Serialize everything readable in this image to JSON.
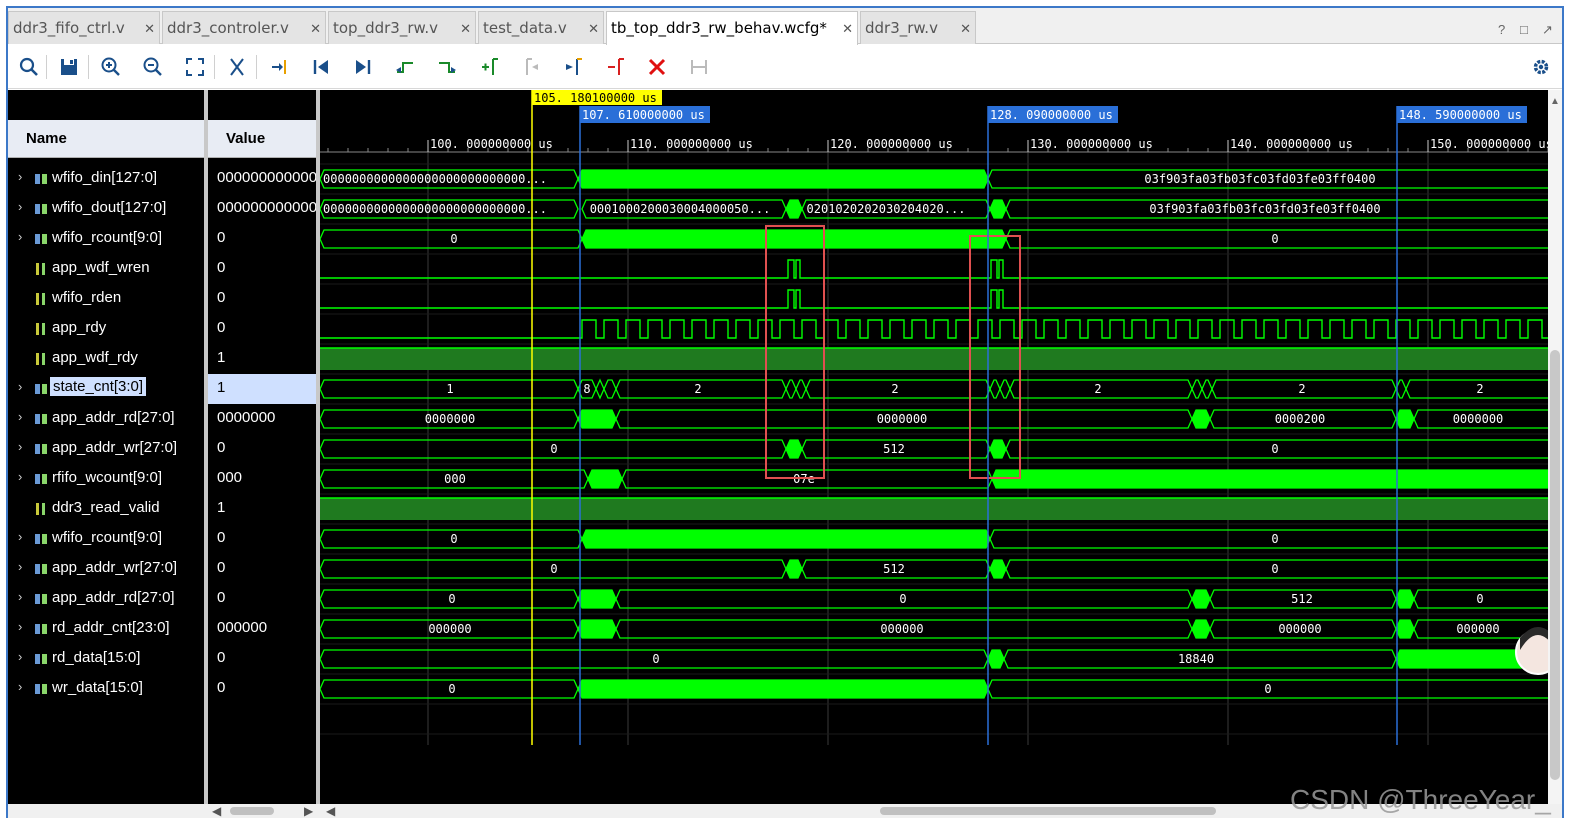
{
  "tabs": [
    {
      "label": "ddr3_fifo_ctrl.v",
      "active": false
    },
    {
      "label": "ddr3_controler.v",
      "active": false
    },
    {
      "label": "top_ddr3_rw.v",
      "active": false
    },
    {
      "label": "test_data.v",
      "active": false
    },
    {
      "label": "tb_top_ddr3_rw_behav.wcfg*",
      "active": true
    },
    {
      "label": "ddr3_rw.v",
      "active": false
    }
  ],
  "window_controls": [
    "?",
    "□",
    "↗"
  ],
  "toolbar_icons": [
    "search-icon",
    "save-icon",
    "zoom-in-icon",
    "zoom-out-icon",
    "zoom-fit-icon",
    "cut-icon",
    "go-to-cursor-icon",
    "go-to-time-zero-icon",
    "go-to-last-time-icon",
    "previous-transition-icon",
    "next-transition-icon",
    "add-marker-icon",
    "previous-marker-icon",
    "next-marker-icon",
    "swap-cursors-icon",
    "delete-icon",
    "snap-to-transition-icon",
    "gear-icon"
  ],
  "columns": {
    "name": "Name",
    "value": "Value"
  },
  "signals": [
    {
      "name": "wfifo_din[127:0]",
      "value": "000000000000000",
      "bus": true
    },
    {
      "name": "wfifo_dout[127:0]",
      "value": "000000000000000",
      "bus": true
    },
    {
      "name": "wfifo_rcount[9:0]",
      "value": "0",
      "bus": true
    },
    {
      "name": "app_wdf_wren",
      "value": "0",
      "bus": false
    },
    {
      "name": "wfifo_rden",
      "value": "0",
      "bus": false
    },
    {
      "name": "app_rdy",
      "value": "0",
      "bus": false
    },
    {
      "name": "app_wdf_rdy",
      "value": "1",
      "bus": false
    },
    {
      "name": "state_cnt[3:0]",
      "value": "1",
      "bus": true,
      "selected": true
    },
    {
      "name": "app_addr_rd[27:0]",
      "value": "0000000",
      "bus": true
    },
    {
      "name": "app_addr_wr[27:0]",
      "value": "0",
      "bus": true
    },
    {
      "name": "rfifo_wcount[9:0]",
      "value": "000",
      "bus": true
    },
    {
      "name": "ddr3_read_valid",
      "value": "1",
      "bus": false
    },
    {
      "name": "wfifo_rcount[9:0]",
      "value": "0",
      "bus": true
    },
    {
      "name": "app_addr_wr[27:0]",
      "value": "0",
      "bus": true
    },
    {
      "name": "app_addr_rd[27:0]",
      "value": "0",
      "bus": true
    },
    {
      "name": "rd_addr_cnt[23:0]",
      "value": "000000",
      "bus": true
    },
    {
      "name": "rd_data[15:0]",
      "value": "0",
      "bus": true
    },
    {
      "name": "wr_data[15:0]",
      "value": "0",
      "bus": true
    }
  ],
  "timeline": {
    "unit": "us",
    "ticks": [
      "100. 000000000 us",
      "110. 000000000 us",
      "120. 000000000 us",
      "130. 000000000 us",
      "140. 000000000 us",
      "150. 000000000 us"
    ],
    "cursor": "105. 180100000  us",
    "markers": [
      "107. 610000000  us",
      "128. 090000000  us",
      "148. 590000000  us"
    ]
  },
  "wave_labels": {
    "din_a": "0000000000000000000000000000...",
    "din_b": "03f903fa03fb03fc03fd03fe03ff0400",
    "dout_a": "0000000000000000000000000000...",
    "dout_b": "0001000200030004000050...",
    "dout_c": "0201020202030204020...",
    "dout_d": "03f903fa03fb03fc03fd03fe03ff0400",
    "rcount_a": "0",
    "rcount_b": "0",
    "state_1": "1",
    "state_8": "8",
    "state_2a": "2",
    "state_2b": "2",
    "state_2c": "2",
    "state_2d": "2",
    "state_2e": "2",
    "addr_rd_a": "0000000",
    "addr_rd_b": "0000000",
    "addr_rd_c": "0000200",
    "addr_rd_d": "0000000",
    "addr_wr_a": "0",
    "addr_wr_b": "512",
    "addr_wr_c": "0",
    "rfifo_a": "000",
    "rfifo_b": "07e",
    "rcount2_a": "0",
    "rcount2_b": "0",
    "addr_wr2_a": "0",
    "addr_wr2_b": "512",
    "addr_wr2_c": "0",
    "addr_rd2_a": "0",
    "addr_rd2_b": "0",
    "addr_rd2_c": "512",
    "addr_rd2_d": "0",
    "rdcnt_a": "000000",
    "rdcnt_b": "000000",
    "rdcnt_c": "000000",
    "rdcnt_d": "000000",
    "rd_data_a": "0",
    "rd_data_b": "18840",
    "wr_data_a": "0",
    "wr_data_b": "0"
  },
  "watermark": "CSDN @ThreeYear_",
  "colors": {
    "wave": "#00ff00",
    "cursor": "#ffff00",
    "marker": "#2a6fd8",
    "highlight_box": "#e05050"
  }
}
